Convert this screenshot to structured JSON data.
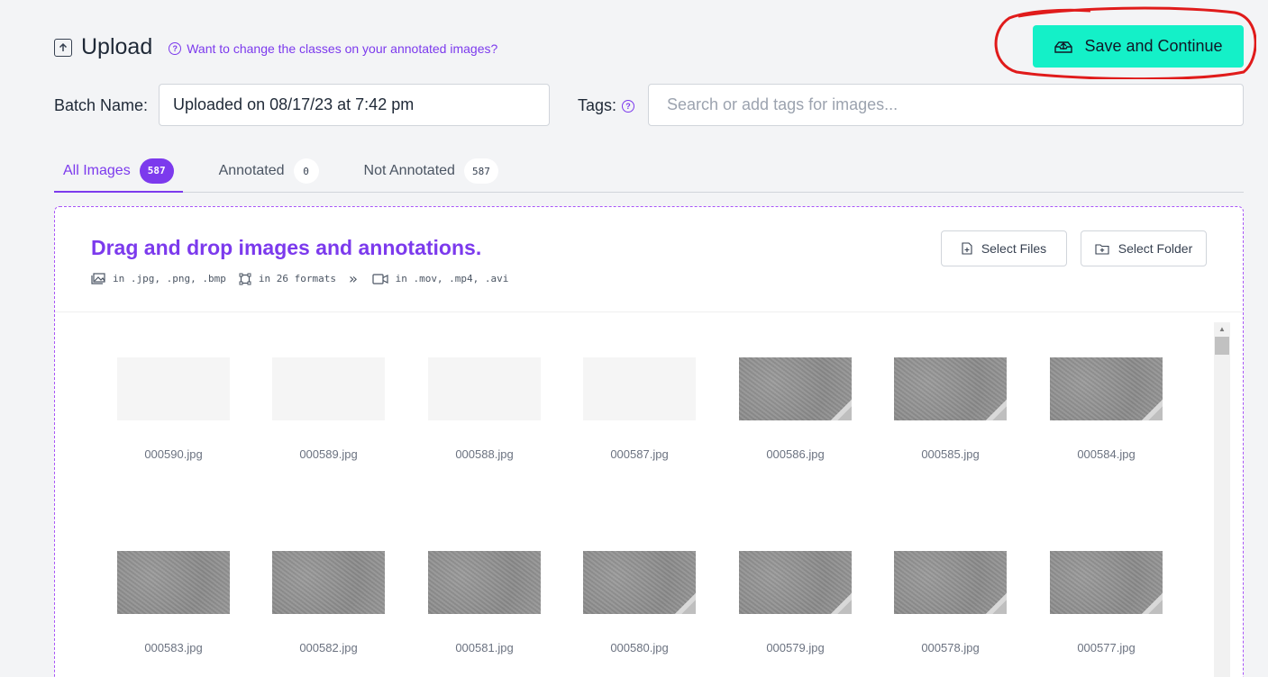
{
  "header": {
    "title": "Upload",
    "help_link": "Want to change the classes on your annotated images?",
    "save_button": "Save and Continue"
  },
  "batch": {
    "label": "Batch Name:",
    "value": "Uploaded on 08/17/23 at 7:42 pm"
  },
  "tags": {
    "label": "Tags:",
    "placeholder": "Search or add tags for images..."
  },
  "tabs": [
    {
      "label": "All Images",
      "count": "587",
      "active": true
    },
    {
      "label": "Annotated",
      "count": "0",
      "active": false
    },
    {
      "label": "Not Annotated",
      "count": "587",
      "active": false
    }
  ],
  "dropzone": {
    "title": "Drag and drop images and annotations.",
    "formats": [
      {
        "icon": "image-icon",
        "text": "in .jpg, .png, .bmp"
      },
      {
        "icon": "bounding-box-icon",
        "text": "in 26 formats"
      },
      {
        "icon": "video-icon",
        "text": "in .mov, .mp4, .avi"
      }
    ],
    "select_files": "Select Files",
    "select_folder": "Select Folder"
  },
  "images": [
    {
      "name": "000590.jpg",
      "style": "blank"
    },
    {
      "name": "000589.jpg",
      "style": "blank"
    },
    {
      "name": "000588.jpg",
      "style": "blank"
    },
    {
      "name": "000587.jpg",
      "style": "blank"
    },
    {
      "name": "000586.jpg",
      "style": "road"
    },
    {
      "name": "000585.jpg",
      "style": "road"
    },
    {
      "name": "000584.jpg",
      "style": "road"
    },
    {
      "name": "000583.jpg",
      "style": "road"
    },
    {
      "name": "000582.jpg",
      "style": "road"
    },
    {
      "name": "000581.jpg",
      "style": "road"
    },
    {
      "name": "000580.jpg",
      "style": "road"
    },
    {
      "name": "000579.jpg",
      "style": "road"
    },
    {
      "name": "000578.jpg",
      "style": "road"
    },
    {
      "name": "000577.jpg",
      "style": "road"
    }
  ],
  "colors": {
    "accent": "#7c3aed",
    "save_button": "#14f0c8",
    "annotation_circle": "#e01b1b"
  }
}
